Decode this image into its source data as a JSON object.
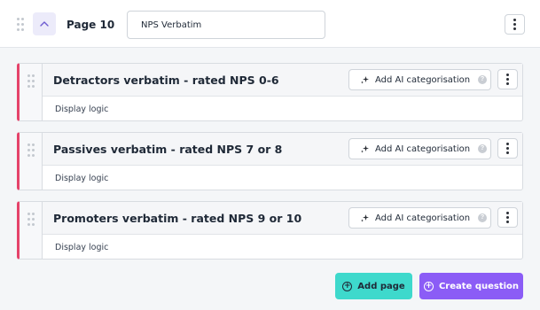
{
  "page": {
    "title": "Page 10",
    "name_value": "NPS Verbatim"
  },
  "questions": [
    {
      "title": "Detractors verbatim - rated NPS 0-6",
      "ai_button": "Add AI categorisation",
      "logic": "Display logic"
    },
    {
      "title": "Passives verbatim - rated NPS 7 or 8",
      "ai_button": "Add AI categorisation",
      "logic": "Display logic"
    },
    {
      "title": "Promoters verbatim - rated NPS 9 or 10",
      "ai_button": "Add AI categorisation",
      "logic": "Display logic"
    }
  ],
  "footer": {
    "add_page": "Add page",
    "create_question": "Create question"
  },
  "icons": {
    "collapse": "chevron-up-icon",
    "menu": "kebab-icon",
    "drag": "drag-handle-icon",
    "ai": "sparkle-icon",
    "info": "info-icon",
    "add": "plus-circle-icon"
  },
  "colors": {
    "accent_purple": "#8b5cf6",
    "accent_teal": "#3ed9cc",
    "question_border": "#e5436a",
    "collapse_bg": "#ecebfa"
  }
}
